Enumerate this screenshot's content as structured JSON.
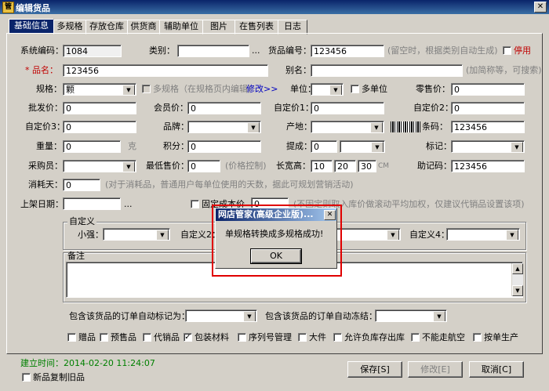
{
  "window": {
    "title": "编辑货品",
    "close_glyph": "✕",
    "app_glyph": "管"
  },
  "tabs": [
    "基础信息",
    "多规格",
    "存放仓库",
    "供货商",
    "辅助单位",
    "图片",
    "在售列表",
    "日志"
  ],
  "form": {
    "system_code_label": "系统编码：",
    "system_code_value": "1084",
    "category_label": "类别：",
    "category_ellipsis": "...",
    "item_no_label": "货品编号：",
    "item_no_value": "123456",
    "item_no_hint": "(留空时，根据类别自动生成)",
    "disable_label": "停用",
    "name_label": "* 品名：",
    "name_value": "123456",
    "alias_label": "别名：",
    "alias_hint": "(加简称等，可搜索)",
    "spec_label": "规格：",
    "spec_value": "颗",
    "multi_spec_label": "多规格（在规格页内编辑）",
    "modify_link": "修改>>",
    "unit_label": "单位：",
    "multi_unit_label": "多单位",
    "retail_price_label": "零售价：",
    "retail_price_value": "0",
    "wholesale_label": "批发价：",
    "wholesale_value": "0",
    "member_price_label": "会员价：",
    "member_price_value": "0",
    "custom_price1_label": "自定价1：",
    "custom_price1_value": "0",
    "custom_price2_label": "自定价2：",
    "custom_price2_value": "0",
    "custom_price3_label": "自定价3：",
    "custom_price3_value": "0",
    "brand_label": "品牌：",
    "origin_label": "产地：",
    "barcode_label": "条码：",
    "barcode_value": "123456",
    "weight_label": "重量：",
    "weight_value": "0",
    "weight_unit": "克",
    "points_label": "积分：",
    "points_value": "0",
    "commission_label": "提成：",
    "commission_value": "0",
    "mark_label": "标记：",
    "buyer_label": "采购员：",
    "min_price_label": "最低售价：",
    "min_price_value": "0",
    "min_price_hint": "(价格控制)",
    "dims_label": "长宽高：",
    "dims_l": "10",
    "dims_w": "20",
    "dims_h": "30",
    "dims_unit": "CM",
    "mnemonic_label": "助记码：",
    "mnemonic_value": "123456",
    "consume_days_label": "消耗天：",
    "consume_days_value": "0",
    "consume_days_hint": "(对于消耗品，普通用户每单位使用的天数，据此可规划营销活动)",
    "shelf_date_label": "上架日期：",
    "shelf_date_ellipsis": "...",
    "fixed_cost_label": "固定成本价",
    "fixed_cost_value": "0",
    "fixed_cost_hint": "(不固定则取入库价做滚动平均加权，仅建议代销品设置该项)",
    "custom_group_title": "自定义",
    "xiaoqiang_label": "小强：",
    "custom2_label": "自定义2：",
    "custom4_label": "自定义4：",
    "remark_label": "备注",
    "order_mark_label": "包含该货品的订单自动标记为：",
    "order_freeze_label": "包含该货品的订单自动冻结：",
    "checkboxes": [
      {
        "label": "赠品",
        "checked": false
      },
      {
        "label": "预售品",
        "checked": false
      },
      {
        "label": "代销品",
        "checked": false
      },
      {
        "label": "包装材料",
        "checked": true
      },
      {
        "label": "序列号管理",
        "checked": false
      },
      {
        "label": "大件",
        "checked": false
      },
      {
        "label": "允许负库存出库",
        "checked": false
      },
      {
        "label": "不能走航空",
        "checked": false
      },
      {
        "label": "按单生产",
        "checked": false
      }
    ],
    "check_glyph": "✓"
  },
  "footer": {
    "created_label": "建立时间：2014-02-20 11:24:07",
    "copy_old_label": "新品复制旧品",
    "save_label": "保存[S]",
    "modify_label": "修改[E]",
    "cancel_label": "取消[C]"
  },
  "dialog": {
    "title": "网店管家(高级企业版)...",
    "message": "单规格转换成多规格成功!",
    "ok_label": "OK",
    "close_glyph": "✕"
  },
  "colors": {
    "highlight": "#e00000",
    "title_bar": "#0a246a"
  }
}
